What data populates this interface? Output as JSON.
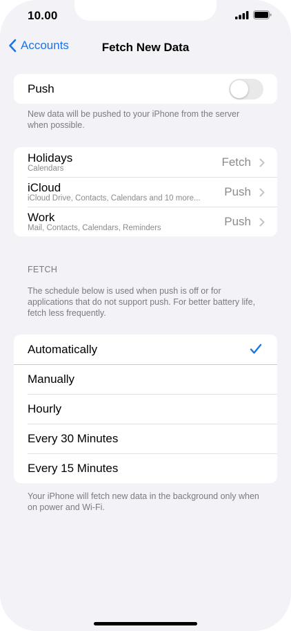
{
  "status_bar": {
    "time": "10.00",
    "signal_icon": "signal-bars-icon",
    "battery_icon": "battery-icon"
  },
  "nav": {
    "back_label": "Accounts",
    "title": "Fetch New Data"
  },
  "push": {
    "label": "Push",
    "enabled": false,
    "footnote": "New data will be pushed to your iPhone from the server when possible."
  },
  "accounts": [
    {
      "name": "Holidays",
      "subtitle": "Calendars",
      "value": "Fetch"
    },
    {
      "name": "iCloud",
      "subtitle": "iCloud Drive, Contacts, Calendars and 10 more...",
      "value": "Push"
    },
    {
      "name": "Work",
      "subtitle": "Mail, Contacts, Calendars, Reminders",
      "value": "Push"
    }
  ],
  "fetch": {
    "header": "FETCH",
    "description": "The schedule below is used when push is off or for applications that do not support push. For better battery life, fetch less frequently.",
    "options": [
      "Automatically",
      "Manually",
      "Hourly",
      "Every 30 Minutes",
      "Every 15 Minutes"
    ],
    "selected": "Automatically",
    "footnote": "Your iPhone will fetch new data in the background only when on power and Wi-Fi."
  },
  "colors": {
    "accent": "#1a73e8",
    "background": "#f2f2f7"
  }
}
